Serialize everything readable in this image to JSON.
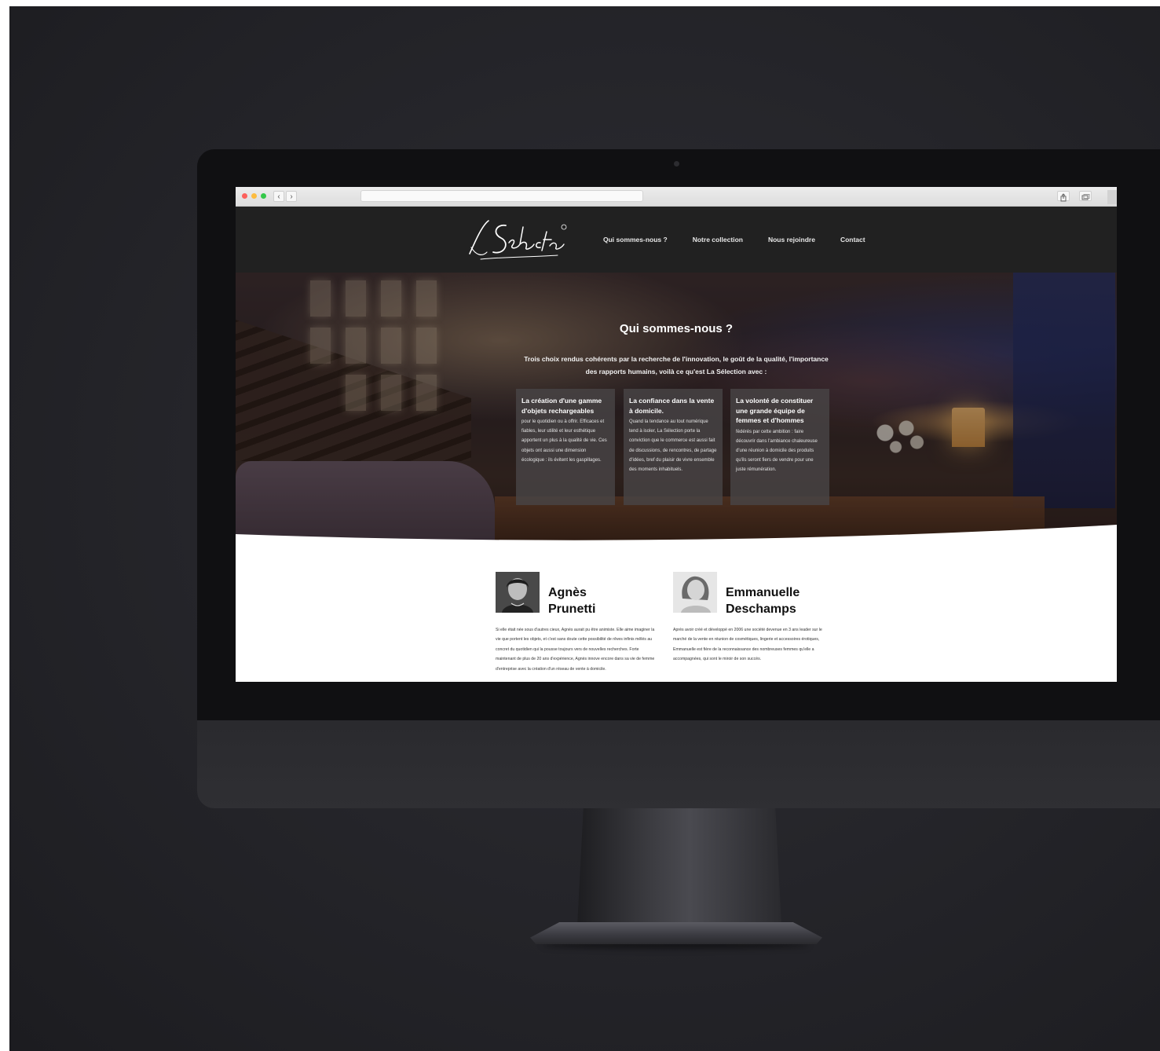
{
  "colors": {
    "backdrop": "#26262b",
    "header_bg": "#212121",
    "card_bg": "#48444b",
    "traffic_red": "#fc605c",
    "traffic_yellow": "#fdbc40",
    "traffic_green": "#34c84a"
  },
  "browser": {
    "back_icon": "chevron-left-icon",
    "forward_icon": "chevron-right-icon",
    "share_icon": "share-icon",
    "tabs_icon": "tabs-icon"
  },
  "header": {
    "logo_text": "La Sélection",
    "nav": [
      {
        "label": "Qui sommes-nous ?"
      },
      {
        "label": "Notre collection"
      },
      {
        "label": "Nous rejoindre"
      },
      {
        "label": "Contact"
      }
    ]
  },
  "hero": {
    "title": "Qui sommes-nous ?",
    "intro": "Trois choix rendus cohérents par la recherche de l'innovation, le goût de la qualité, l'importance des rapports humains, voilà ce qu'est La Sélection avec :",
    "cards": [
      {
        "title": "La création d'une gamme d'objets rechargeables",
        "text": "pour le quotidien ou à offrir. Efficaces et fiables, leur utilité et leur esthétique apportent un plus à la qualité de vie. Ces objets ont aussi une dimension écologique : ils évitent les gaspillages."
      },
      {
        "title": "La confiance dans la vente à domicile.",
        "text": "Quand la tendance au tout numérique tend à isoler, La Sélection porte la conviction que le commerce est aussi fait de discussions, de rencontres, de partage d'idées, bref du plaisir de vivre ensemble des moments inhabituels."
      },
      {
        "title": "La volonté de constituer une grande équipe de femmes et d'hommes",
        "text": "fédérés par cette ambition : faire découvrir dans l'ambiance chaleureuse d'une réunion à domicile des produits qu'ils seront fiers de vendre pour une juste rémunération."
      }
    ]
  },
  "profiles": [
    {
      "first_name": "Agnès",
      "last_name": "Prunetti",
      "bio": "Si elle était née sous d'autres cieux, Agnès aurait pu être animiste. Elle aime imaginer la vie que portent les objets, et c'est sans doute cette possibilité de rêves infinis mêlés au concret du quotidien qui la pousse toujours vers de nouvelles recherches. Forte maintenant de plus de 20 ans d'expérience, Agnès innove encore dans sa vie de femme d'entreprise avec la création d'un réseau de vente à domicile."
    },
    {
      "first_name": "Emmanuelle",
      "last_name": "Deschamps",
      "bio": "Après avoir créé et développé en 2006 une société devenue en 3 ans leader sur le marché de la vente en réunion de cosmétiques, lingerie et accessoires érotiques, Emmanuelle est fière de la reconnaissance des nombreuses femmes qu'elle a accompagnées, qui sont le miroir de son succès."
    }
  ]
}
